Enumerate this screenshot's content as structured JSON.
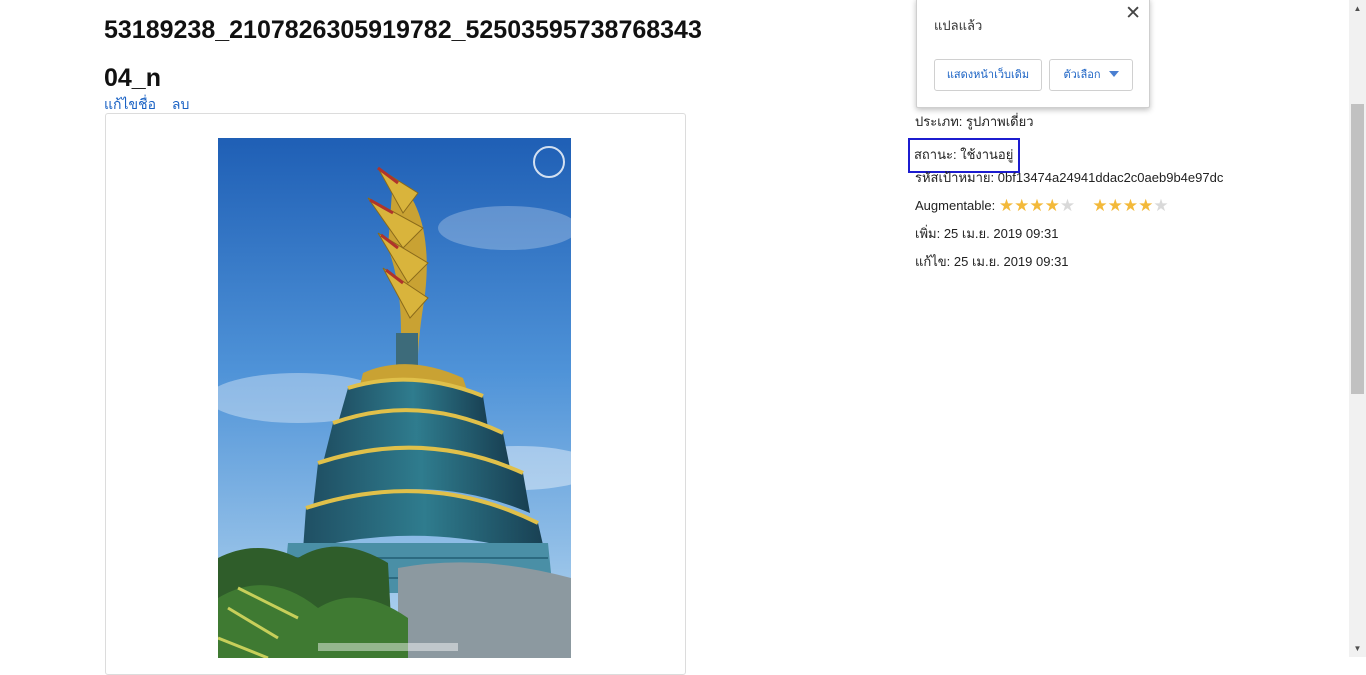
{
  "page": {
    "title": "53189238_2107826305919782_5250359573876834304_n",
    "actions": {
      "rename": "แก้ไขชื่อ",
      "delete": "ลบ"
    }
  },
  "metadata": {
    "type_label": "ประเภท:",
    "type_value": "รูปภาพเดี่ยว",
    "status_label": "สถานะ:",
    "status_value": "ใช้งานอยู่",
    "target_id_label": "รหัสเป้าหมาย:",
    "target_id_value": "0bf13474a24941ddac2c0aeb9b4e97dc",
    "augmentable_label": "Augmentable:",
    "augmentable_rating": 4,
    "augmentable_rating_max": 5,
    "augmentable_rating_2": 4,
    "added_label": "เพิ่ม:",
    "added_value": "25 เม.ย. 2019 09:31",
    "edited_label": "แก้ไข:",
    "edited_value": "25 เม.ย. 2019 09:31"
  },
  "translate_popup": {
    "message": "แปลแล้ว",
    "show_original": "แสดงหน้าเว็บเดิม",
    "options": "ตัวเลือก",
    "close_symbol": "✕"
  },
  "colors": {
    "link": "#1a62c4",
    "status_highlight": "#1c1ccf",
    "star_on": "#f3b93a",
    "star_off": "#d9d9d9"
  }
}
